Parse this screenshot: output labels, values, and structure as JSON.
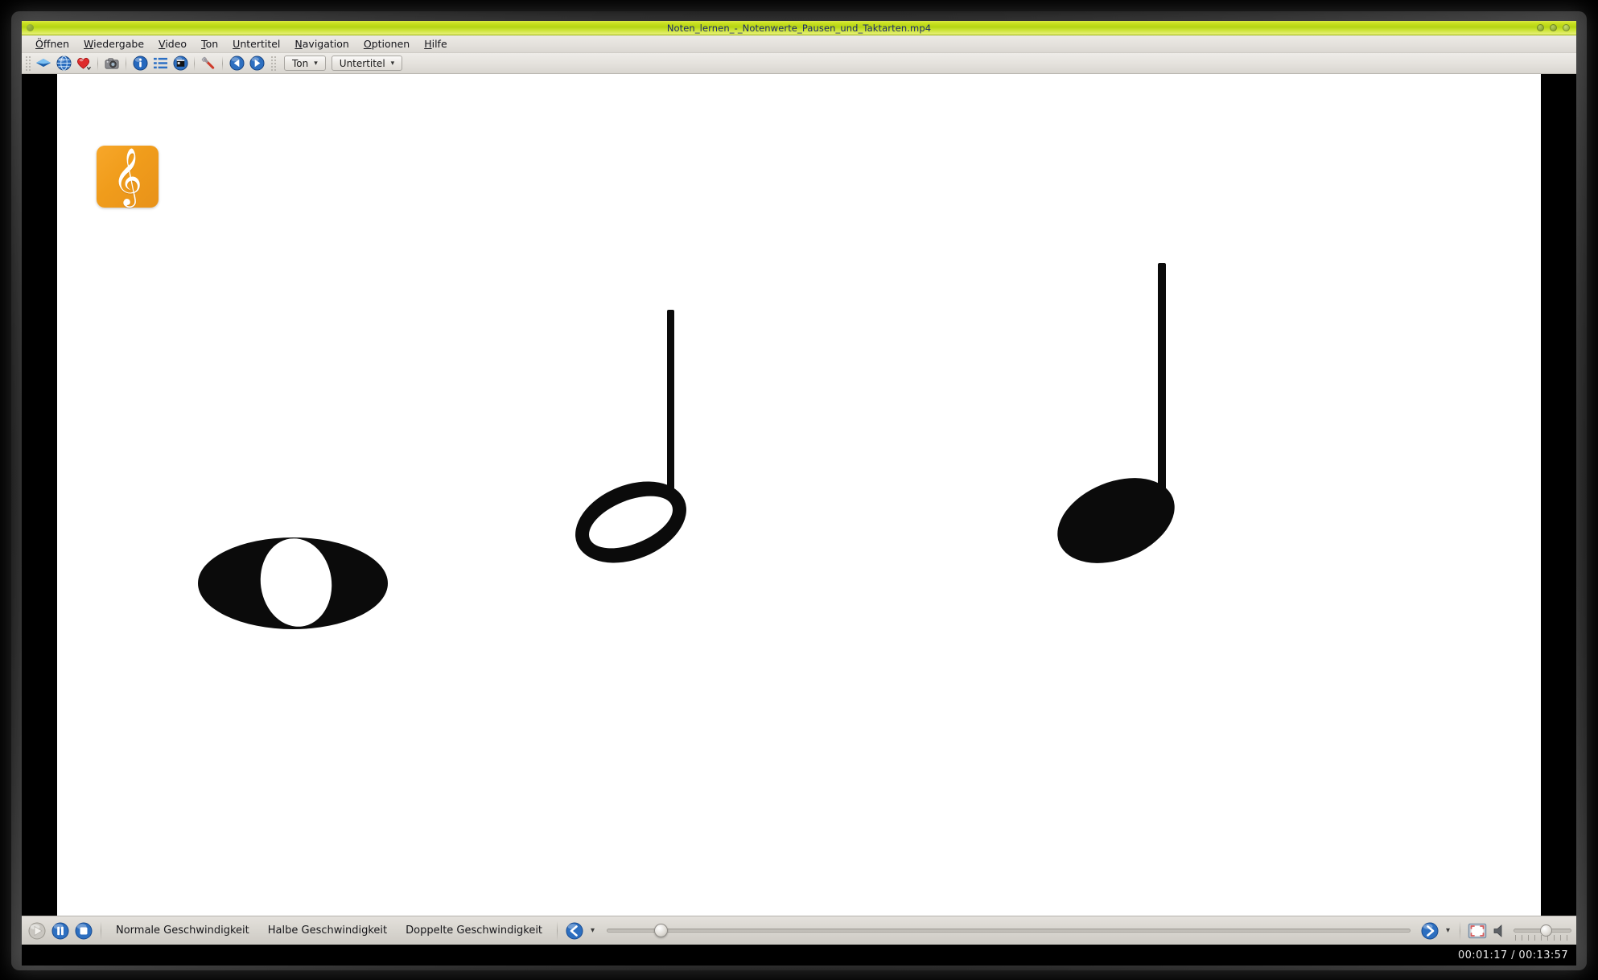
{
  "window": {
    "title": "Noten_lernen_-_Notenwerte_Pausen_und_Taktarten.mp4",
    "controls": [
      "minimize",
      "maximize",
      "close"
    ],
    "accent_titlebar": "#c8e01e",
    "title_color": "#1d2b6b"
  },
  "menubar": {
    "items": [
      {
        "label": "Öffnen",
        "mnemonic": "Ö"
      },
      {
        "label": "Wiedergabe",
        "mnemonic": "W"
      },
      {
        "label": "Video",
        "mnemonic": "V"
      },
      {
        "label": "Ton",
        "mnemonic": "T"
      },
      {
        "label": "Untertitel",
        "mnemonic": "U"
      },
      {
        "label": "Navigation",
        "mnemonic": "N"
      },
      {
        "label": "Optionen",
        "mnemonic": "O"
      },
      {
        "label": "Hilfe",
        "mnemonic": "H"
      }
    ]
  },
  "toolbar": {
    "buttons": [
      {
        "icon": "blue-diamond-icon",
        "title": "Öffnen"
      },
      {
        "icon": "globe-icon",
        "title": "URL öffnen"
      },
      {
        "icon": "heart-icon",
        "title": "Favoriten"
      },
      {
        "icon": "camera-icon",
        "title": "Schnappschuss"
      },
      {
        "icon": "info-icon",
        "title": "Information"
      },
      {
        "icon": "playlist-icon",
        "title": "Wiedergabeliste"
      },
      {
        "icon": "capture-icon",
        "title": "Aufnahme"
      },
      {
        "icon": "screwdriver-icon",
        "title": "Einstellungen"
      },
      {
        "icon": "previous-icon",
        "title": "Vorheriges"
      },
      {
        "icon": "next-icon",
        "title": "Nächstes"
      }
    ],
    "dropdowns": [
      {
        "label": "Ton"
      },
      {
        "label": "Untertitel"
      }
    ]
  },
  "video": {
    "background": "#ffffff",
    "logo": {
      "name": "treble-clef-logo",
      "glyph": "𝄞",
      "bg": "#f09c1b"
    },
    "notes": [
      {
        "name": "whole-note",
        "german": "Ganze Note",
        "value": "1/1",
        "filled": false,
        "stem": false
      },
      {
        "name": "half-note",
        "german": "Halbe Note",
        "value": "1/2",
        "filled": false,
        "stem": true
      },
      {
        "name": "quarter-note",
        "german": "Viertelnote",
        "value": "1/4",
        "filled": true,
        "stem": true
      }
    ]
  },
  "controls": {
    "play_label": "Wiedergabe",
    "pause_label": "Pause",
    "stop_label": "Stopp",
    "speeds": [
      {
        "label": "Normale Geschwindigkeit"
      },
      {
        "label": "Halbe Geschwindigkeit"
      },
      {
        "label": "Doppelte Geschwindigkeit"
      }
    ],
    "rewind_label": "Zurückspulen",
    "forward_label": "Vorspulen",
    "fullscreen_label": "Vollbild",
    "mute_label": "Stumm",
    "seek_percent": 9,
    "volume_percent": 50
  },
  "status": {
    "timecode": "00:01:17 / 00:13:57",
    "elapsed": "00:01:17",
    "duration": "00:13:57"
  }
}
